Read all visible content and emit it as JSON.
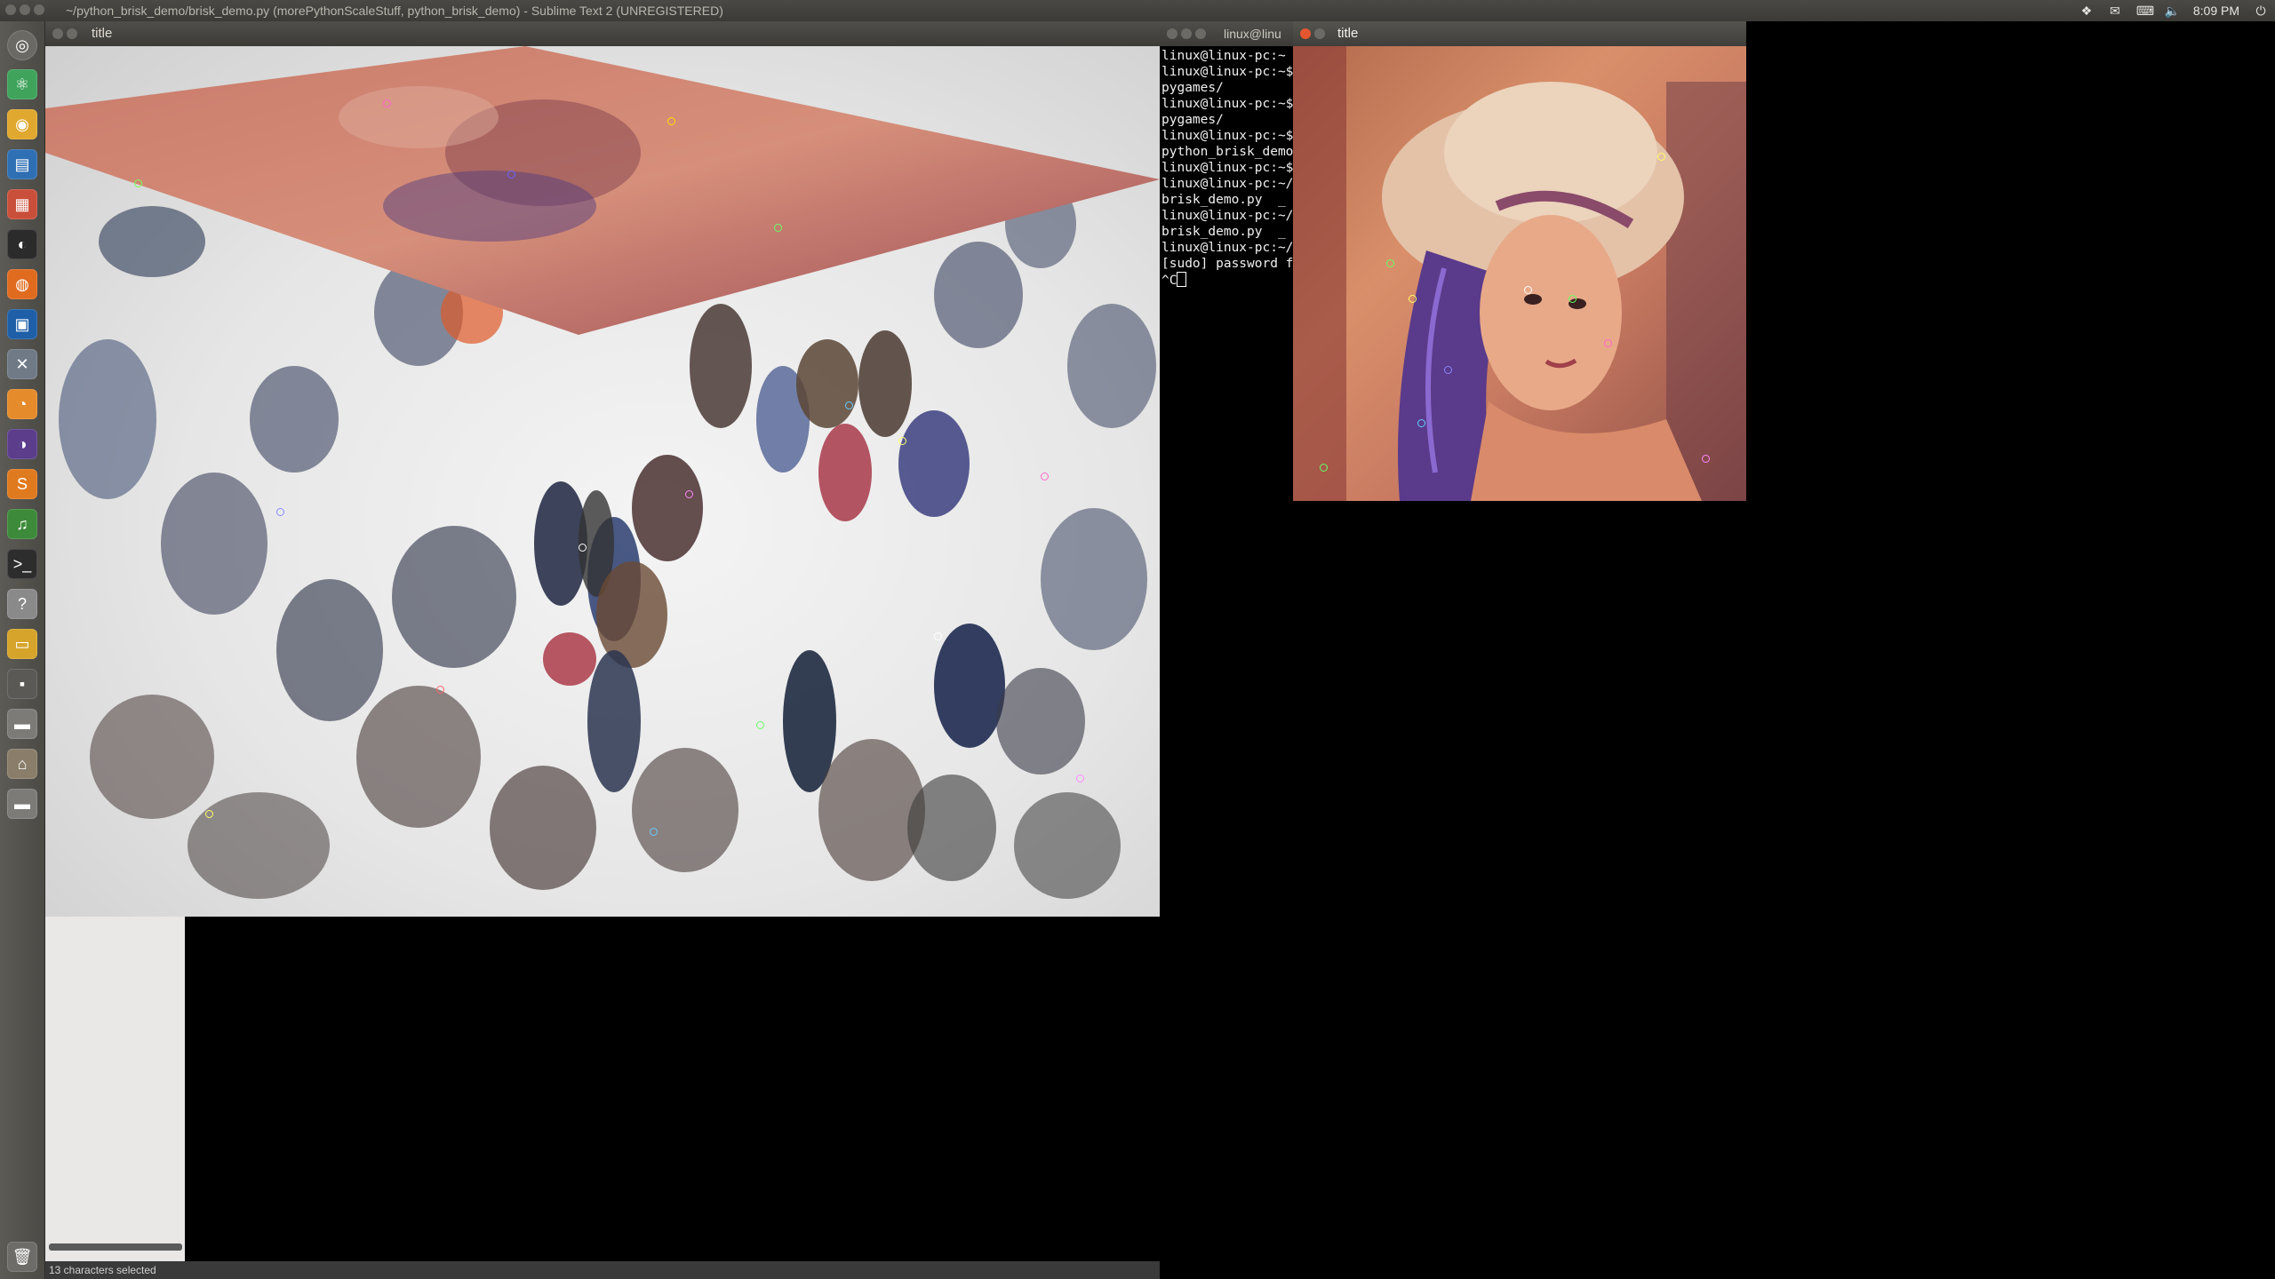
{
  "top_panel": {
    "app_title": "~/python_brisk_demo/brisk_demo.py (morePythonScaleStuff, python_brisk_demo) - Sublime Text 2 (UNREGISTERED)",
    "clock": "8:09 PM"
  },
  "launcher": {
    "items": [
      "dash-home",
      "atom-app",
      "chrome-app",
      "libreoffice-writer",
      "calculator",
      "steam",
      "firefox",
      "virtualbox",
      "system-settings",
      "blender",
      "eclipse",
      "sublime-text",
      "spotify",
      "terminal",
      "help",
      "scanner",
      "workspace-switcher",
      "drive-1",
      "home-folder",
      "drive-2",
      "trash"
    ]
  },
  "window_crowd": {
    "title": "title"
  },
  "terminal": {
    "title": "linux@linu",
    "lines": [
      "linux@linux-pc:~",
      "linux@linux-pc:~$",
      "pygames/",
      "linux@linux-pc:~$",
      "pygames/",
      "linux@linux-pc:~$",
      "python_brisk_demo",
      "linux@linux-pc:~$",
      "linux@linux-pc:~/",
      "brisk_demo.py  _",
      "linux@linux-pc:~/",
      "brisk_demo.py  _",
      "linux@linux-pc:~/",
      "[sudo] password f",
      "^C"
    ]
  },
  "window_portrait": {
    "title": "title"
  },
  "status_bar": {
    "text": "13 characters selected"
  }
}
